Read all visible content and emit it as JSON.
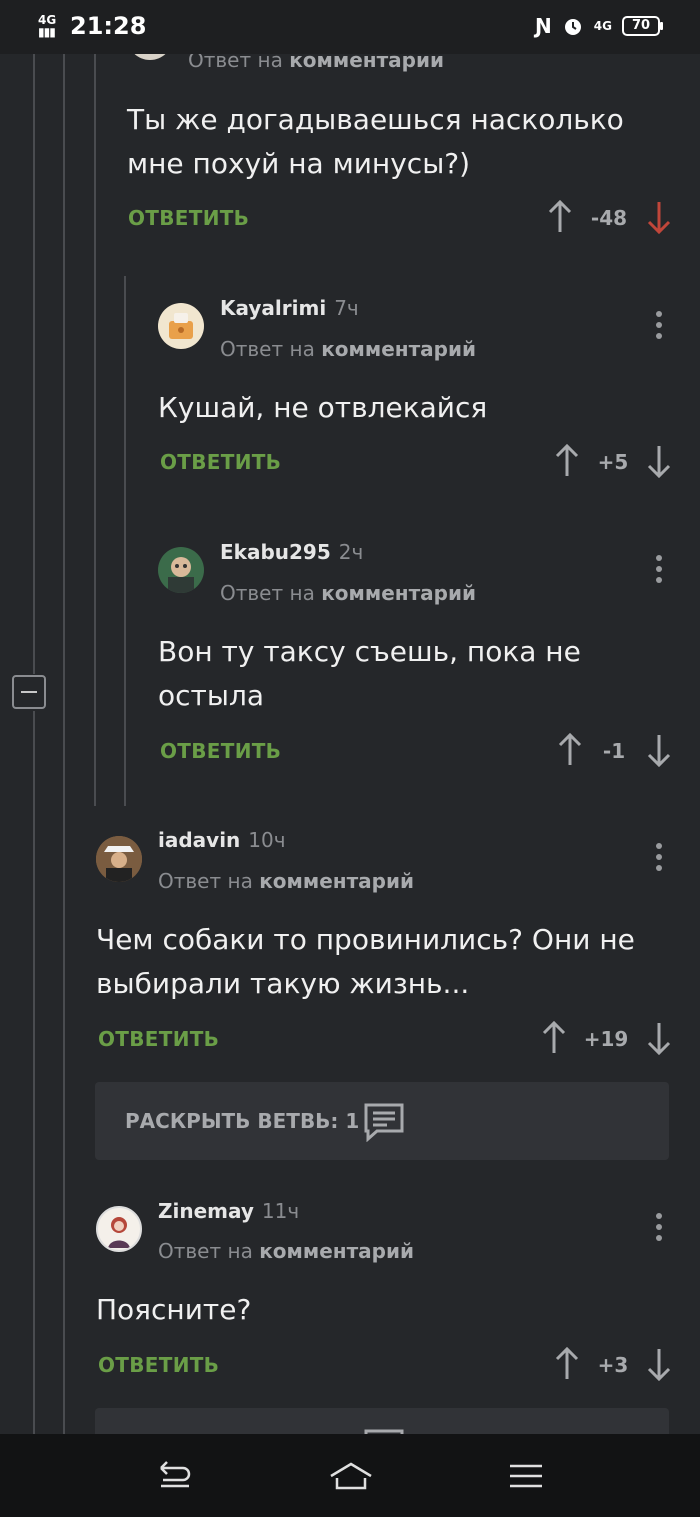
{
  "status_bar": {
    "network_left": "4G",
    "time": "21:28",
    "network_right": "4G",
    "battery": "70"
  },
  "labels": {
    "reply": "ОТВЕТИТЬ",
    "reply_to_prefix": "Ответ на",
    "reply_to_bold": "комментарий"
  },
  "comments": [
    {
      "reply_to_prefix": "Ответ на",
      "reply_to_bold": "комментарии",
      "text": "Ты же догадываешься насколько мне похуй на минусы?)",
      "score": "-48"
    },
    {
      "username": "Kayalrimi",
      "time": "7ч",
      "text": "Кушай, не отвлекайся",
      "score": "+5"
    },
    {
      "username": "Ekabu295",
      "time": "2ч",
      "text": "Вон ту таксу съешь, пока не остыла",
      "score": "-1"
    },
    {
      "username": "iadavin",
      "time": "10ч",
      "text": "Чем собаки то провинились? Они не выбирали такую жизнь...",
      "score": "+19"
    },
    {
      "username": "Zinemay",
      "time": "11ч",
      "text": "Поясните?",
      "score": "+3"
    }
  ],
  "expand_branch": {
    "label": "РАСКРЫТЬ ВЕТВЬ: 1"
  },
  "colors": {
    "background": "#25272a",
    "reply_green": "#6a9e47",
    "downvote_red": "#c0463a",
    "text_gray": "#8a8c90"
  },
  "icons": [
    "upvote-arrow-icon",
    "downvote-arrow-icon",
    "more-options-icon",
    "comments-icon",
    "back-icon",
    "home-icon",
    "menu-icon"
  ]
}
